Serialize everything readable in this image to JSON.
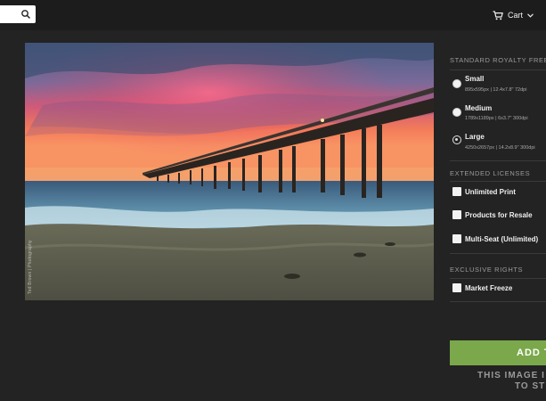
{
  "header": {
    "search": {
      "value": "",
      "placeholder": ""
    },
    "cart_label": "Cart"
  },
  "photo": {
    "watermark": "Ted Brown | Photography"
  },
  "panel": {
    "standard_title": "STANDARD ROYALTY FREE",
    "sizes": [
      {
        "name": "Small",
        "detail": "895x595px | 12.4x7.8\" 72dpi",
        "selected": false
      },
      {
        "name": "Medium",
        "detail": "1789x1189px | 6x3.7\" 300dpi",
        "selected": false
      },
      {
        "name": "Large",
        "detail": "4250x2657px | 14.2x8.9\" 300dpi",
        "selected": true
      }
    ],
    "extended_title": "EXTENDED LICENSES",
    "extended": [
      {
        "label": "Unlimited Print",
        "checked": false
      },
      {
        "label": "Products for Resale",
        "checked": false
      },
      {
        "label": "Multi-Seat (Unlimited)",
        "checked": false
      }
    ],
    "exclusive_title": "EXCLUSIVE RIGHTS",
    "exclusive": [
      {
        "label": "Market Freeze",
        "checked": false
      }
    ],
    "add_button": "ADD T",
    "notice_line1": "THIS IMAGE I",
    "notice_line2": "TO ST"
  },
  "colors": {
    "background": "#232323",
    "topbar": "#1c1c1c",
    "accent_green": "#7aa84a"
  }
}
